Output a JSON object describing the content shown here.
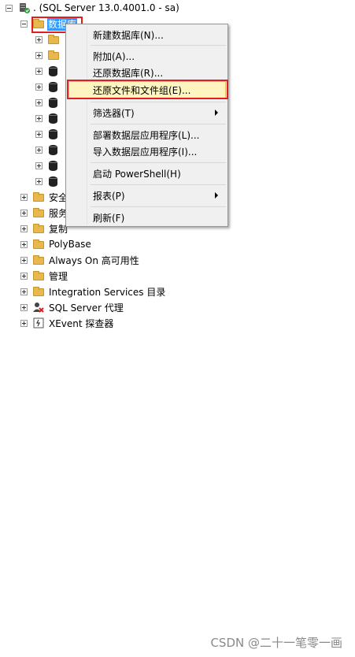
{
  "server": {
    "label": ". (SQL Server 13.0.4001.0 - sa)"
  },
  "databases": {
    "label": "数据库"
  },
  "tree_items": [
    {
      "label": "安全"
    },
    {
      "label": "服务"
    },
    {
      "label": "复制"
    },
    {
      "label": "PolyBase"
    },
    {
      "label": "Always On 高可用性"
    },
    {
      "label": "管理"
    },
    {
      "label": "Integration Services 目录"
    },
    {
      "label": "SQL Server 代理"
    },
    {
      "label": "XEvent 探查器"
    }
  ],
  "context_menu": {
    "items": [
      {
        "label": "新建数据库(N)..."
      },
      {
        "label": "附加(A)..."
      },
      {
        "label": "还原数据库(R)..."
      },
      {
        "label": "还原文件和文件组(E)..."
      },
      {
        "label": "筛选器(T)"
      },
      {
        "label": "部署数据层应用程序(L)..."
      },
      {
        "label": "导入数据层应用程序(I)..."
      },
      {
        "label": "启动 PowerShell(H)"
      },
      {
        "label": "报表(P)"
      },
      {
        "label": "刷新(F)"
      }
    ],
    "highlighted": "还原文件和文件组(E)..."
  },
  "watermark": "CSDN @二十一笔零一画",
  "colors": {
    "selection": "#3399ff",
    "highlight": "#fdf4bf",
    "callout": "#e02020",
    "folder": "#e8b84e"
  }
}
